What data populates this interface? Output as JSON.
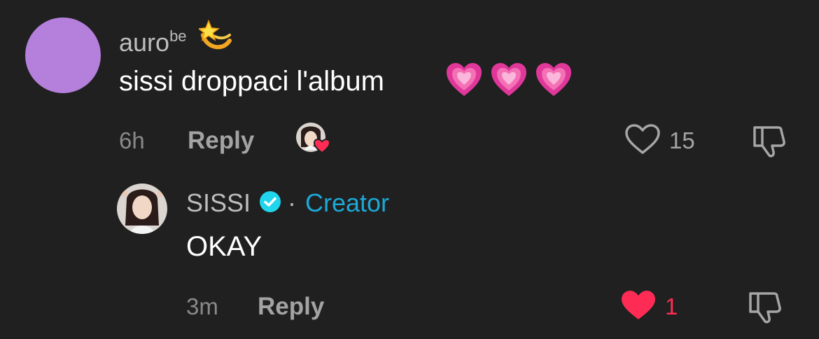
{
  "comment": {
    "username": "auro",
    "username_superscript": "be",
    "text": "sissi droppaci l'album",
    "time": "6h",
    "reply_label": "Reply",
    "like_count": "15",
    "avatar_color": "#b57fdc",
    "icons": {
      "username_emoji": "shooting-star-emoji",
      "text_emojis": [
        "growing-heart-emoji",
        "growing-heart-emoji",
        "growing-heart-emoji"
      ],
      "creator_liked_badge": "creator-liked-avatar-heart",
      "like": "heart-outline-icon",
      "dislike": "thumbs-down-icon"
    }
  },
  "reply": {
    "username": "SISSI",
    "separator": "·",
    "badge": "Creator",
    "text": "OKAY",
    "time": "3m",
    "reply_label": "Reply",
    "like_count": "1",
    "liked": true,
    "icons": {
      "verified": "verified-check-icon",
      "like": "heart-filled-icon",
      "dislike": "thumbs-down-icon"
    }
  },
  "colors": {
    "background": "#202020",
    "creator_accent": "#1da8d6",
    "like_red": "#fe2c55",
    "muted_text": "#8a8a8a"
  }
}
